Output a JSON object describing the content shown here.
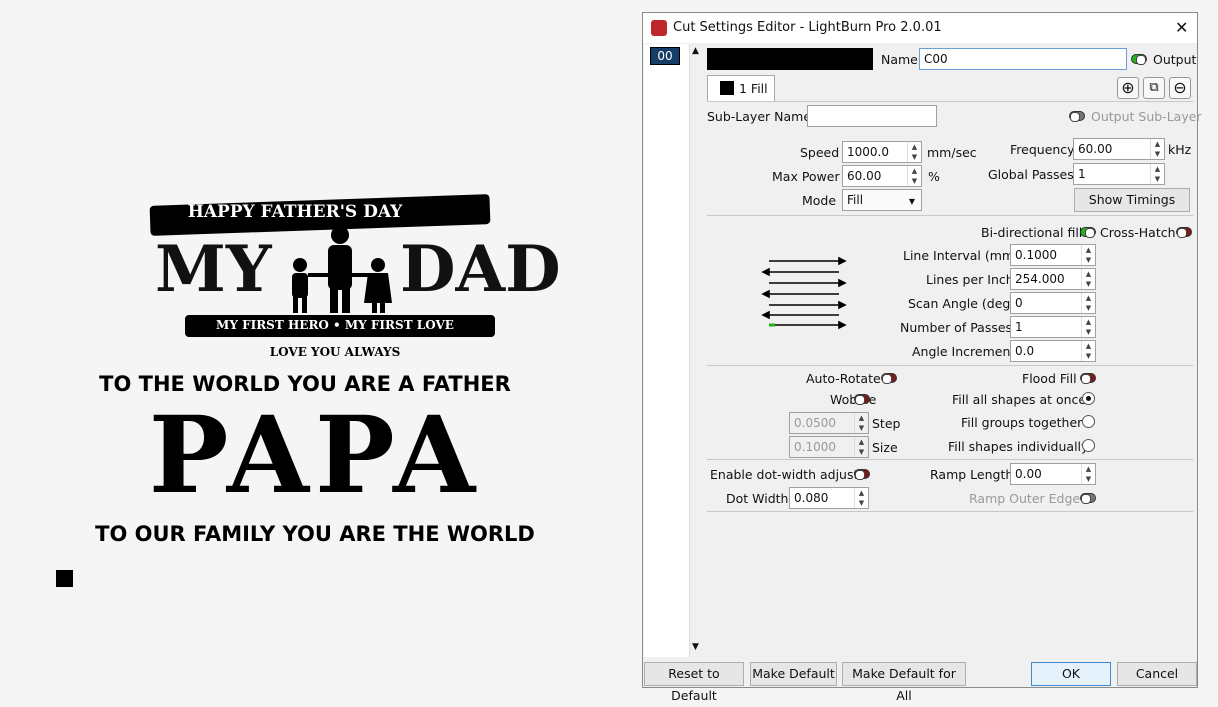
{
  "artwork": {
    "line1": "HAPPY FATHER'S DAY",
    "line2a": "MY",
    "line2b": "DAD",
    "line3": "MY FIRST HERO • MY FIRST LOVE",
    "line4": "LOVE YOU ALWAYS",
    "line5": "TO THE WORLD YOU ARE A FATHER",
    "line6": "PAPA",
    "line7": "TO OUR FAMILY YOU ARE THE WORLD"
  },
  "dialog": {
    "title": "Cut Settings Editor - LightBurn Pro 2.0.01",
    "close": "✕",
    "layer_id": "00",
    "name_label": "Name",
    "name_value": "C00",
    "output_label": "Output",
    "tab_label": "1 Fill",
    "sublayer_label": "Sub-Layer Name",
    "sublayer_value": "",
    "output_sublayer_label": "Output Sub-Layer",
    "speed_label": "Speed",
    "speed_value": "1000.0",
    "speed_unit": "mm/sec",
    "maxpower_label": "Max Power",
    "maxpower_value": "60.00",
    "maxpower_unit": "%",
    "mode_label": "Mode",
    "mode_value": "Fill",
    "frequency_label": "Frequency",
    "frequency_value": "60.00",
    "frequency_unit": "kHz",
    "globalpasses_label": "Global Passes",
    "globalpasses_value": "1",
    "show_timings": "Show Timings",
    "bidir_label": "Bi-directional fill",
    "crosshatch_label": "Cross-Hatch",
    "line_interval_label": "Line Interval (mm)",
    "line_interval_value": "0.1000",
    "lpi_label": "Lines per Inch",
    "lpi_value": "254.000",
    "scan_angle_label": "Scan Angle (deg)",
    "scan_angle_value": "0",
    "num_passes_label": "Number of Passes",
    "num_passes_value": "1",
    "angle_inc_label": "Angle Increment",
    "angle_inc_value": "0.0",
    "autorotate_label": "Auto-Rotate",
    "floodfill_label": "Flood Fill",
    "wobble_label": "Wobble",
    "fill_all_label": "Fill all shapes at once",
    "step_value": "0.0500",
    "step_label": "Step",
    "fill_groups_label": "Fill groups together",
    "size_value": "0.1000",
    "size_label": "Size",
    "fill_indiv_label": "Fill shapes individually",
    "dotwidth_adjust_label": "Enable dot-width adjust",
    "ramp_length_label": "Ramp Length",
    "ramp_length_value": "0.00",
    "dot_width_label": "Dot Width:",
    "dot_width_value": "0.080",
    "ramp_outer_label": "Ramp Outer Edge",
    "reset_default": "Reset to Default",
    "make_default": "Make Default",
    "make_default_all": "Make Default for All",
    "ok": "OK",
    "cancel": "Cancel"
  }
}
